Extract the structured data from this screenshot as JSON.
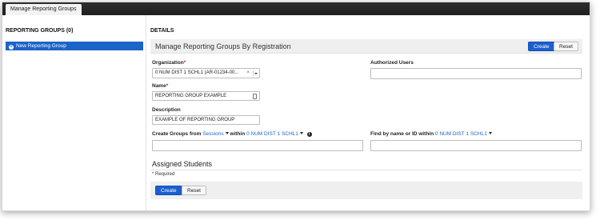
{
  "topbar": {
    "tab_label": "Manage Reporting Groups"
  },
  "sidebar": {
    "title": "REPORTING GROUPS (0)",
    "items": [
      {
        "label": "New Reporting Group",
        "icon": "plus-circle-icon"
      }
    ]
  },
  "main": {
    "section_title": "DETAILS",
    "panel": {
      "title": "Manage Reporting Groups By Registration",
      "create_label": "Create",
      "reset_label": "Reset"
    },
    "organization": {
      "label": "Organization",
      "required_mark": "*",
      "value": "0 NUM DIST 1 SCHL1 (AR-01234-00...",
      "clear": "×"
    },
    "name": {
      "label": "Name",
      "required_mark": "*",
      "value": "REPORTING GROUP EXAMPLE"
    },
    "description": {
      "label": "Description",
      "value": "EXAMPLE OF REPORTING GROUP"
    },
    "authorized_users": {
      "label": "Authorized Users",
      "value": ""
    },
    "create_groups": {
      "prefix": "Create Groups from",
      "source_option": "Sessions",
      "within_label": "within",
      "within_option": "0 NUM DIST 1 SCHL1",
      "info": "i",
      "value": ""
    },
    "find": {
      "prefix": "Find by name or ID within",
      "within_option": "0 NUM DIST 1 SCHL1",
      "value": ""
    },
    "assigned_students": {
      "title": "Assigned Students"
    },
    "required_note": "* Required",
    "footer": {
      "create_label": "Create",
      "reset_label": "Reset"
    }
  },
  "colors": {
    "primary": "#1b5fcf",
    "sidebar_selected": "#1b64c8",
    "topbar": "#262626",
    "required": "#c41f1f"
  }
}
